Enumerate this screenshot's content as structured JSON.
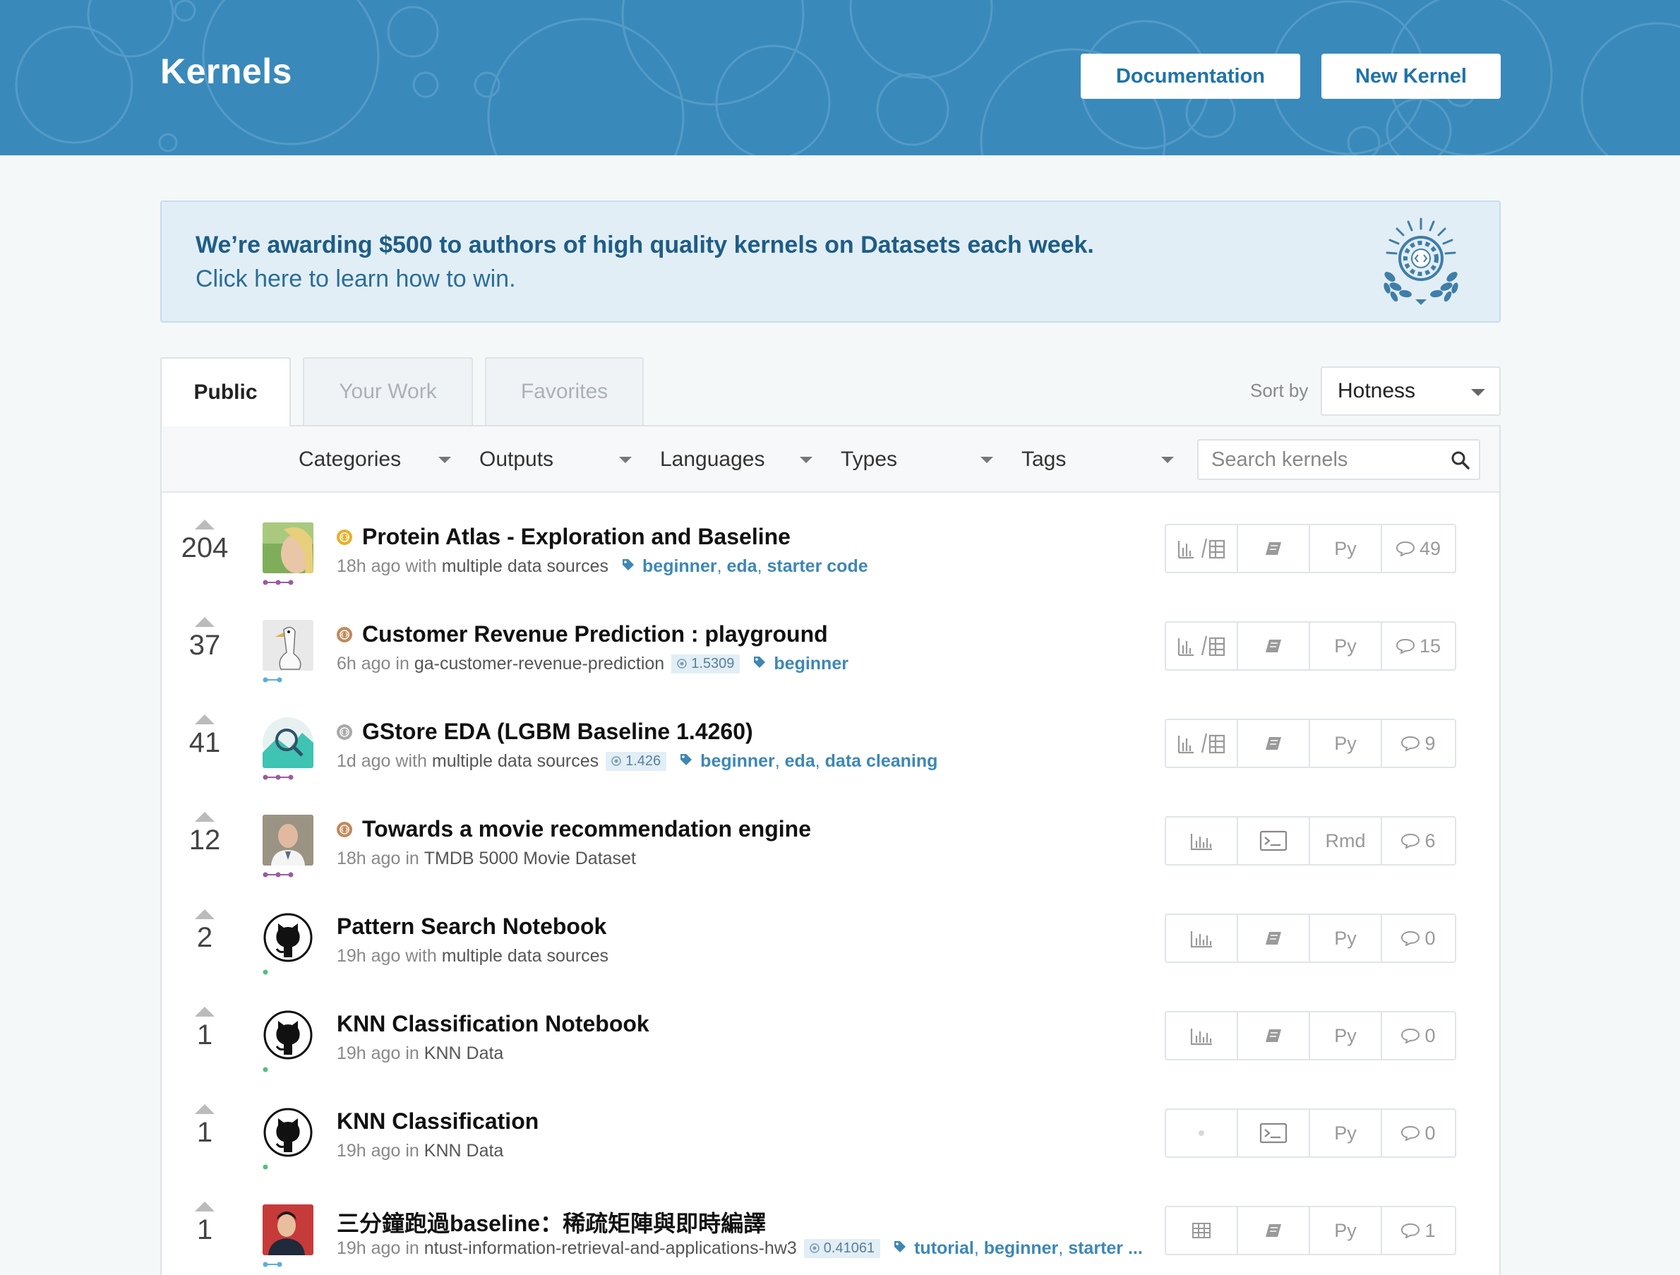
{
  "header": {
    "title": "Kernels",
    "docs_label": "Documentation",
    "new_label": "New Kernel",
    "bg_color": "#3a89bb"
  },
  "banner": {
    "line1": "We’re awarding $500 to authors of high quality kernels on Datasets each week.",
    "line2": "Click here to learn how to win.",
    "icon": "award-laurel-icon"
  },
  "tabs": [
    "Public",
    "Your Work",
    "Favorites"
  ],
  "sort": {
    "label": "Sort by",
    "value": "Hotness"
  },
  "filters": [
    "Categories",
    "Outputs",
    "Languages",
    "Types",
    "Tags"
  ],
  "search": {
    "placeholder": "Search kernels"
  },
  "kernels": [
    {
      "votes": "204",
      "title": "Protein Atlas - Exploration and Baseline",
      "medal": "gold",
      "time": "18h ago",
      "connector": "with",
      "source": "multiple data sources",
      "score": "",
      "tags": [
        "beginner",
        "eda",
        "starter code"
      ],
      "output": "chart-table-icon",
      "type": "notebook-icon",
      "lang": "Py",
      "comments": "49",
      "tier": "grandmaster"
    },
    {
      "votes": "37",
      "title": "Customer Revenue Prediction : playground",
      "medal": "bronze",
      "time": "6h ago",
      "connector": "in",
      "source": "ga-customer-revenue-prediction",
      "score": "1.5309",
      "tags": [
        "beginner"
      ],
      "output": "chart-table-icon",
      "type": "notebook-icon",
      "lang": "Py",
      "comments": "15",
      "tier": "expert"
    },
    {
      "votes": "41",
      "title": "GStore EDA (LGBM Baseline 1.4260)",
      "medal": "silver",
      "time": "1d ago",
      "connector": "with",
      "source": "multiple data sources",
      "score": "1.426",
      "tags": [
        "beginner",
        "eda",
        "data cleaning"
      ],
      "output": "chart-table-icon",
      "type": "notebook-icon",
      "lang": "Py",
      "comments": "9",
      "tier": "grandmaster"
    },
    {
      "votes": "12",
      "title": "Towards a movie recommendation engine",
      "medal": "bronze",
      "time": "18h ago",
      "connector": "in",
      "source": "TMDB 5000 Movie Dataset",
      "score": "",
      "tags": [],
      "output": "chart-icon",
      "type": "script-icon",
      "lang": "Rmd",
      "comments": "6",
      "tier": "grandmaster"
    },
    {
      "votes": "2",
      "title": "Pattern Search Notebook",
      "medal": "",
      "time": "19h ago",
      "connector": "with",
      "source": "multiple data sources",
      "score": "",
      "tags": [],
      "output": "chart-icon",
      "type": "notebook-icon",
      "lang": "Py",
      "comments": "0",
      "tier": "novice"
    },
    {
      "votes": "1",
      "title": "KNN Classification Notebook",
      "medal": "",
      "time": "19h ago",
      "connector": "in",
      "source": "KNN Data",
      "score": "",
      "tags": [],
      "output": "chart-icon",
      "type": "notebook-icon",
      "lang": "Py",
      "comments": "0",
      "tier": "novice"
    },
    {
      "votes": "1",
      "title": "KNN Classification",
      "medal": "",
      "time": "19h ago",
      "connector": "in",
      "source": "KNN Data",
      "score": "",
      "tags": [],
      "output": "dot-icon",
      "type": "script-icon",
      "lang": "Py",
      "comments": "0",
      "tier": "novice"
    },
    {
      "votes": "1",
      "title": "三分鐘跑過baseline：稀疏矩陣與即時編譯",
      "medal": "",
      "time": "19h ago",
      "connector": "in",
      "source": "ntust-information-retrieval-and-applications-hw3",
      "score": "0.41061",
      "tags": [
        "tutorial",
        "beginner",
        "starter ..."
      ],
      "output": "table-icon",
      "type": "notebook-icon",
      "lang": "Py",
      "comments": "1",
      "tier": "expert"
    }
  ],
  "colors": {
    "gold": "#e6b12e",
    "silver": "#a9a9a9",
    "bronze": "#c08a5c",
    "tag": "#3d87b6",
    "grandmaster": "#9b5aa3",
    "expert": "#5aaedc",
    "novice": "#52c07e"
  }
}
